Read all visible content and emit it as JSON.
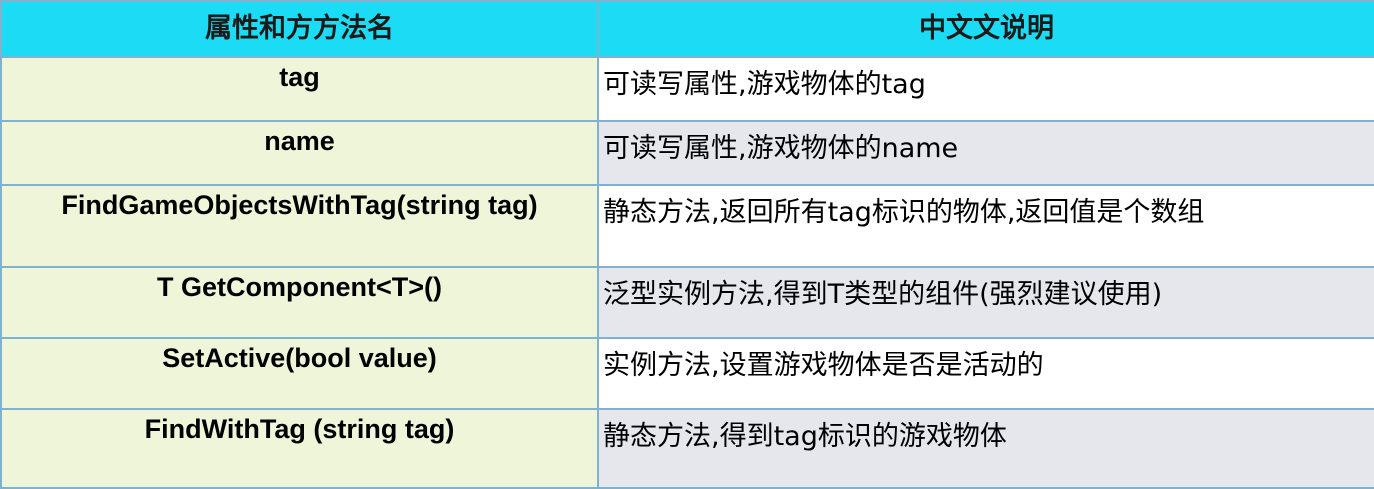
{
  "header": {
    "col1": "属性和方方法名",
    "col2": "中文文说明"
  },
  "rows": [
    {
      "name": "tag",
      "desc": "可读写属性,游戏物体的tag"
    },
    {
      "name": "name",
      "desc": "可读写属性,游戏物体的name"
    },
    {
      "name": "FindGameObjectsWithTag(string tag)",
      "desc": "静态方法,返回所有tag标识的物体,返回值是个数组"
    },
    {
      "name": "T GetComponent<T>()",
      "desc": "泛型实例方法,得到T类型的组件(强烈建议使用)"
    },
    {
      "name": "SetActive(bool value)",
      "desc": "实例方法,设置游戏物体是否是活动的"
    },
    {
      "name": "FindWithTag (string tag)",
      "desc": "静态方法,得到tag标识的游戏物体"
    }
  ],
  "colors": {
    "header_bg": "#1bdcf4",
    "name_bg": "#eef5d9",
    "desc_bg_white": "#ffffff",
    "desc_bg_gray": "#e6e7ec",
    "border": "#7fb2cf"
  }
}
